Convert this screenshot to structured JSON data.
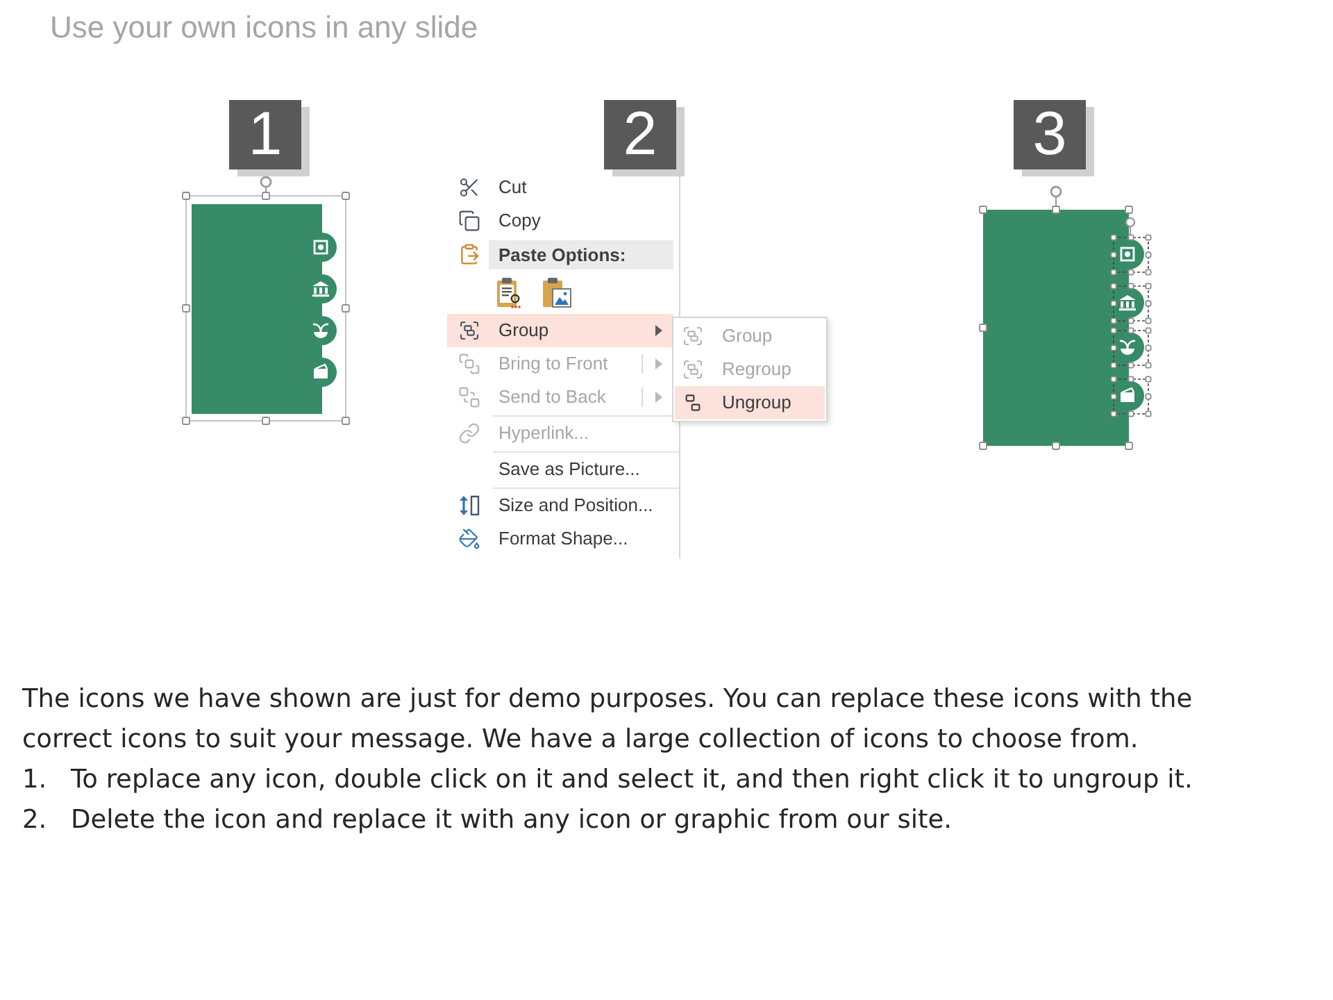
{
  "title": "Use your own icons in any slide",
  "steps": [
    {
      "number": "1",
      "kind": "grouped_shape"
    },
    {
      "number": "2",
      "kind": "context_menu",
      "menu": [
        {
          "kind": "item",
          "label": "Cut",
          "disabled": false,
          "highlighted": false,
          "arrow": false,
          "split": false
        },
        {
          "kind": "item",
          "label": "Copy",
          "disabled": false,
          "highlighted": false,
          "arrow": false,
          "split": false
        },
        {
          "kind": "header",
          "label": "Paste Options:"
        },
        {
          "kind": "paste_icons"
        },
        {
          "kind": "item",
          "label": "Group",
          "disabled": false,
          "highlighted": true,
          "arrow": true,
          "split": false,
          "children": [
            {
              "label": "Group",
              "disabled": true,
              "highlighted": false
            },
            {
              "label": "Regroup",
              "disabled": true,
              "highlighted": false
            },
            {
              "label": "Ungroup",
              "disabled": false,
              "highlighted": true
            }
          ]
        },
        {
          "kind": "item",
          "label": "Bring to Front",
          "disabled": true,
          "highlighted": false,
          "arrow": true,
          "split": true
        },
        {
          "kind": "item",
          "label": "Send to Back",
          "disabled": true,
          "highlighted": false,
          "arrow": true,
          "split": true
        },
        {
          "kind": "separator"
        },
        {
          "kind": "item",
          "label": "Hyperlink...",
          "disabled": true,
          "highlighted": false,
          "arrow": false,
          "split": false
        },
        {
          "kind": "separator"
        },
        {
          "kind": "item",
          "label": "Save as Picture...",
          "disabled": false,
          "highlighted": false,
          "arrow": false,
          "split": false
        },
        {
          "kind": "separator"
        },
        {
          "kind": "item",
          "label": "Size and Position...",
          "disabled": false,
          "highlighted": false,
          "arrow": false,
          "split": false
        },
        {
          "kind": "item",
          "label": "Format Shape...",
          "disabled": false,
          "highlighted": false,
          "arrow": false,
          "split": false
        }
      ]
    },
    {
      "number": "3",
      "kind": "ungrouped_shape"
    }
  ],
  "description": {
    "text": "The icons we have shown are just for demo purposes. You can replace these icons with the correct icons to suit your message. We have a large collection of icons to choose from.",
    "list": [
      {
        "marker": "1.",
        "text": "To replace any icon, double click on it and select it, and then right click it to ungroup it."
      },
      {
        "marker": "2.",
        "text": "Delete the icon and replace it with any icon or graphic from our site."
      }
    ]
  }
}
